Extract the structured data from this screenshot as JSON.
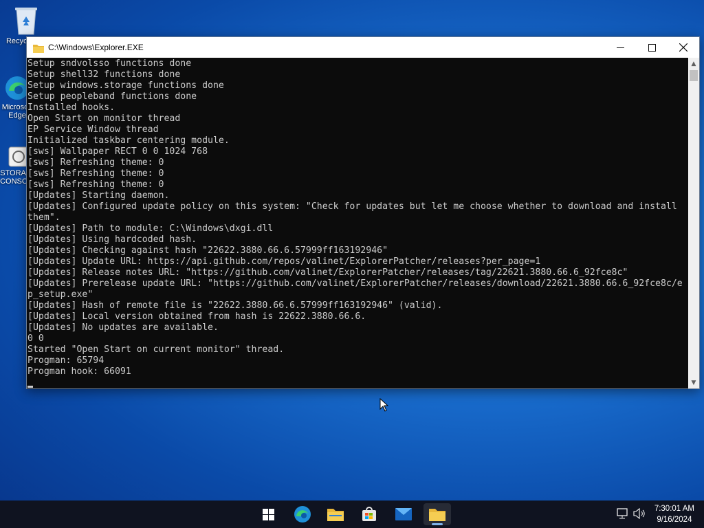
{
  "desktop": {
    "icons": [
      {
        "label": "Recycle Bin",
        "icon": "recycle-bin-icon"
      },
      {
        "label": "Microsoft Edge",
        "icon": "edge-icon"
      },
      {
        "label": "STORAGE CONSOLE",
        "icon": "app-icon"
      }
    ]
  },
  "window": {
    "title": "C:\\Windows\\Explorer.EXE",
    "buttons": {
      "minimize": "minimize-icon",
      "maximize": "maximize-icon",
      "close": "close-icon"
    },
    "console_text": "Setup sndvolsso functions done\nSetup shell32 functions done\nSetup windows.storage functions done\nSetup peopleband functions done\nInstalled hooks.\nOpen Start on monitor thread\nEP Service Window thread\nInitialized taskbar centering module.\n[sws] Wallpaper RECT 0 0 1024 768\n[sws] Refreshing theme: 0\n[sws] Refreshing theme: 0\n[sws] Refreshing theme: 0\n[Updates] Starting daemon.\n[Updates] Configured update policy on this system: \"Check for updates but let me choose whether to download and install\nthem\".\n[Updates] Path to module: C:\\Windows\\dxgi.dll\n[Updates] Using hardcoded hash.\n[Updates] Checking against hash \"22622.3880.66.6.57999ff163192946\"\n[Updates] Update URL: https://api.github.com/repos/valinet/ExplorerPatcher/releases?per_page=1\n[Updates] Release notes URL: \"https://github.com/valinet/ExplorerPatcher/releases/tag/22621.3880.66.6_92fce8c\"\n[Updates] Prerelease update URL: \"https://github.com/valinet/ExplorerPatcher/releases/download/22621.3880.66.6_92fce8c/e\np_setup.exe\"\n[Updates] Hash of remote file is \"22622.3880.66.6.57999ff163192946\" (valid).\n[Updates] Local version obtained from hash is 22622.3880.66.6.\n[Updates] No updates are available.\n0 0\nStarted \"Open Start on current monitor\" thread.\nProgman: 65794\nProgman hook: 66091"
  },
  "taskbar": {
    "apps": [
      {
        "name": "start-button",
        "icon": "windows-logo-icon"
      },
      {
        "name": "edge",
        "icon": "edge-icon"
      },
      {
        "name": "file-explorer",
        "icon": "folder-icon"
      },
      {
        "name": "microsoft-store",
        "icon": "store-icon"
      },
      {
        "name": "mail",
        "icon": "mail-icon"
      },
      {
        "name": "explorer-console",
        "icon": "folder-icon",
        "active": true
      }
    ],
    "tray": {
      "network_icon": "network-icon",
      "volume_icon": "volume-icon"
    },
    "clock": {
      "time": "7:30:01 AM",
      "date": "9/16/2024"
    }
  },
  "colors": {
    "console_bg": "#0c0c0c",
    "console_fg": "#cccccc",
    "taskbar_bg": "#0f1320",
    "desktop_accent": "#1a6fd0"
  }
}
